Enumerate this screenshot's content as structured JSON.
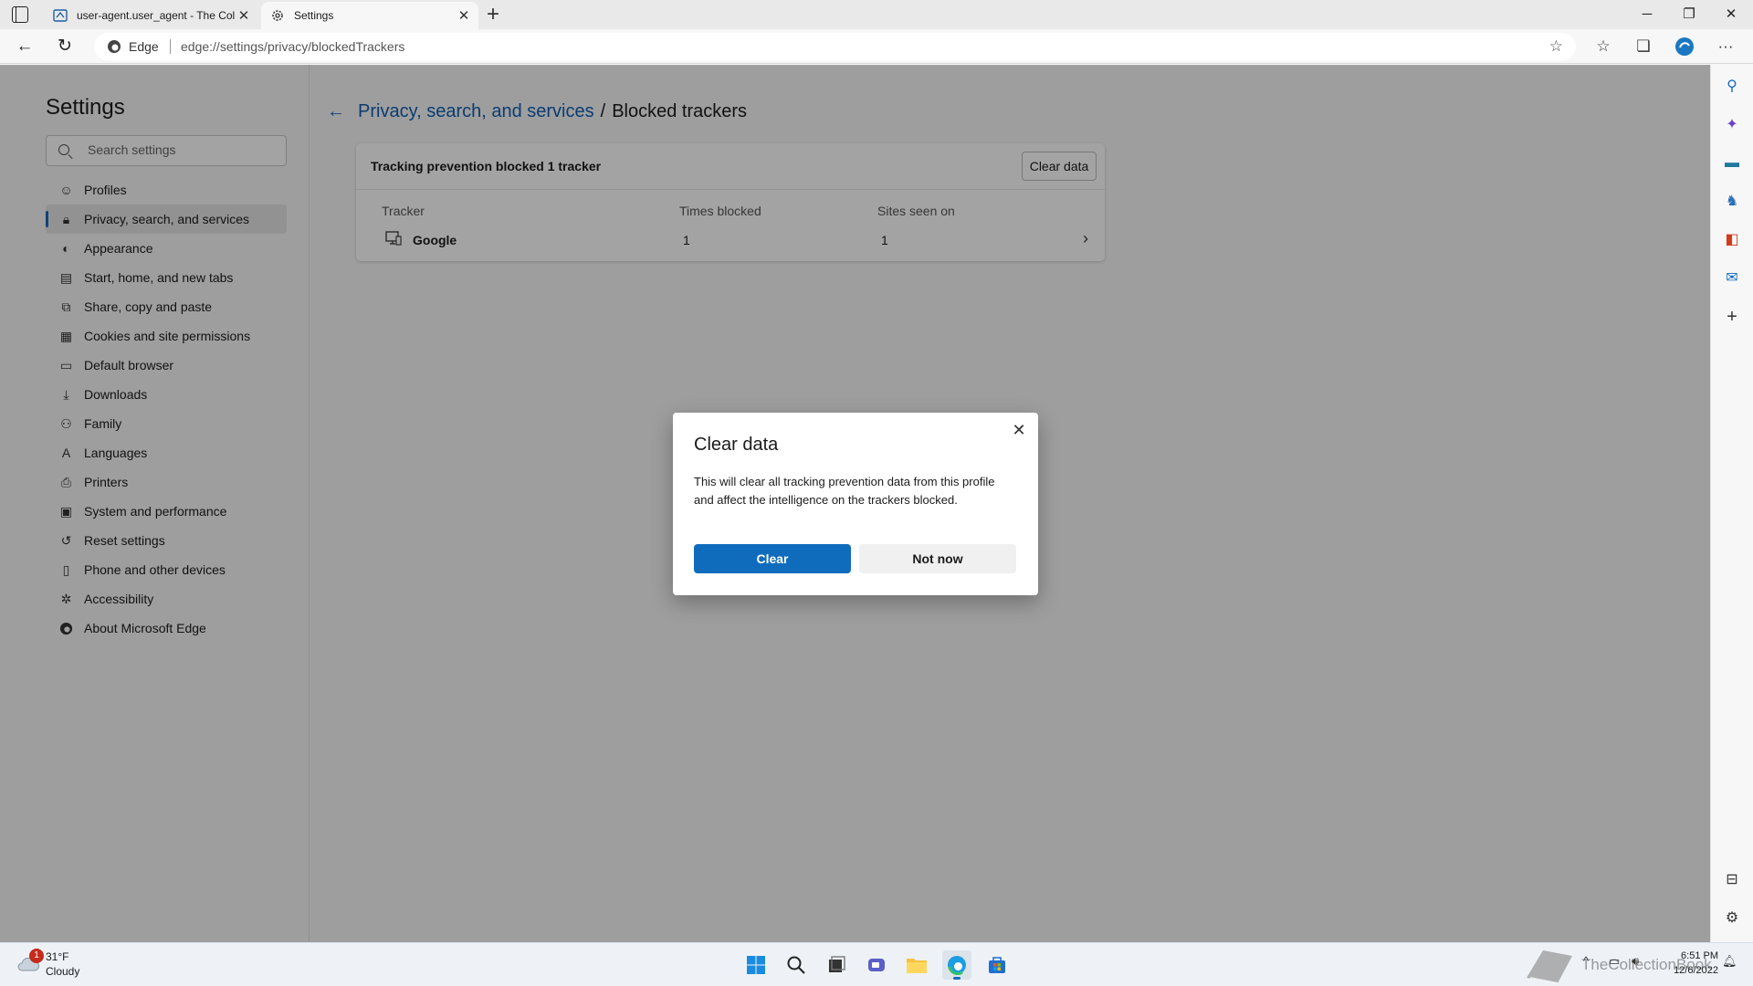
{
  "browser": {
    "tabs": [
      {
        "title": "user-agent.user_agent - The Coll",
        "active": false
      },
      {
        "title": "Settings",
        "active": true
      }
    ],
    "address": {
      "site_label": "Edge",
      "url": "edge://settings/privacy/blockedTrackers"
    }
  },
  "settings": {
    "title": "Settings",
    "search_placeholder": "Search settings",
    "nav_items": [
      {
        "label": "Profiles",
        "icon": "profile-icon"
      },
      {
        "label": "Privacy, search, and services",
        "icon": "lock-icon",
        "selected": true
      },
      {
        "label": "Appearance",
        "icon": "appearance-icon"
      },
      {
        "label": "Start, home, and new tabs",
        "icon": "home-icon"
      },
      {
        "label": "Share, copy and paste",
        "icon": "share-icon"
      },
      {
        "label": "Cookies and site permissions",
        "icon": "cookies-icon"
      },
      {
        "label": "Default browser",
        "icon": "browser-icon"
      },
      {
        "label": "Downloads",
        "icon": "download-icon"
      },
      {
        "label": "Family",
        "icon": "family-icon"
      },
      {
        "label": "Languages",
        "icon": "languages-icon"
      },
      {
        "label": "Printers",
        "icon": "printer-icon"
      },
      {
        "label": "System and performance",
        "icon": "system-icon"
      },
      {
        "label": "Reset settings",
        "icon": "reset-icon"
      },
      {
        "label": "Phone and other devices",
        "icon": "phone-icon"
      },
      {
        "label": "Accessibility",
        "icon": "accessibility-icon"
      },
      {
        "label": "About Microsoft Edge",
        "icon": "edge-logo-icon"
      }
    ]
  },
  "page": {
    "breadcrumb_parent": "Privacy, search, and services",
    "breadcrumb_separator": "/",
    "breadcrumb_current": "Blocked trackers",
    "card_title": "Tracking prevention blocked 1 tracker",
    "clear_data_label": "Clear data",
    "columns": [
      "Tracker",
      "Times blocked",
      "Sites seen on"
    ],
    "rows": [
      {
        "tracker": "Google",
        "times_blocked": "1",
        "sites_seen_on": "1"
      }
    ]
  },
  "dialog": {
    "title": "Clear data",
    "body": "This will clear all tracking prevention data from this profile and affect the intelligence on the trackers blocked.",
    "primary_label": "Clear",
    "secondary_label": "Not now"
  },
  "taskbar": {
    "weather_temp": "31°F",
    "weather_condition": "Cloudy",
    "weather_badge": "1",
    "time": "6:51 PM",
    "date": "12/6/2022",
    "watermark": "TheCollectionBook"
  },
  "colors": {
    "accent": "#0f6cbd",
    "link": "#0f5fb3",
    "nav_selected_bar": "#1a6ac0",
    "badge": "#c42b1c"
  }
}
